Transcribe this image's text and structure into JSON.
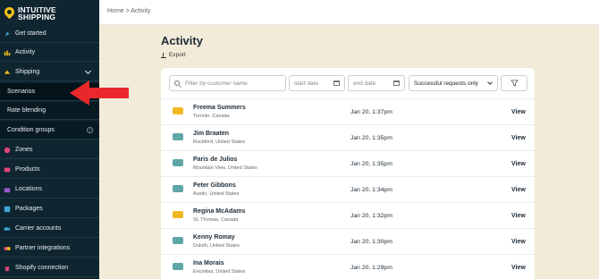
{
  "brand": {
    "line1": "INTUITIVE",
    "line2": "SHIPPING",
    "color": "#f4c21b"
  },
  "sidebar": {
    "items": [
      {
        "label": "Get started",
        "icon": "rocket-icon"
      },
      {
        "label": "Activity",
        "icon": "activity-icon"
      },
      {
        "label": "Shipping",
        "icon": "shipping-icon"
      },
      {
        "label": "Scenarios",
        "sub": true
      },
      {
        "label": "Rate blending",
        "sub": true
      },
      {
        "label": "Condition groups",
        "sub": true
      },
      {
        "label": "Zones",
        "icon": "zones-icon"
      },
      {
        "label": "Products",
        "icon": "products-icon"
      },
      {
        "label": "Locations",
        "icon": "locations-icon"
      },
      {
        "label": "Packages",
        "icon": "packages-icon"
      },
      {
        "label": "Carrier accounts",
        "icon": "truck-icon"
      },
      {
        "label": "Partner integrations",
        "icon": "partner-icon"
      },
      {
        "label": "Shopify connection",
        "icon": "shopify-icon"
      }
    ]
  },
  "breadcrumb": "Home > Activity",
  "page": {
    "title": "Activity",
    "export_label": "Export"
  },
  "filters": {
    "search_placeholder": "Filter by customer name",
    "start_date_placeholder": "start date",
    "end_date_placeholder": "end date",
    "status_selected": "Successful requests only"
  },
  "rows": [
    {
      "name": "Freema Summers",
      "location": "Toronto, Canada",
      "date": "Jan 20, 1:37pm",
      "action": "View",
      "flag": "canada"
    },
    {
      "name": "Jim Braaten",
      "location": "Rockford, United States",
      "date": "Jan 20, 1:35pm",
      "action": "View",
      "flag": "usa"
    },
    {
      "name": "Paris de Julios",
      "location": "Mountain View, United States",
      "date": "Jan 20, 1:35pm",
      "action": "View",
      "flag": "usa"
    },
    {
      "name": "Peter Gibbons",
      "location": "Austin, United States",
      "date": "Jan 20, 1:34pm",
      "action": "View",
      "flag": "usa"
    },
    {
      "name": "Regina McAdams",
      "location": "St. Thomas, Canada",
      "date": "Jan 20, 1:32pm",
      "action": "View",
      "flag": "canada"
    },
    {
      "name": "Kenny Romay",
      "location": "Duluth, United States",
      "date": "Jan 20, 1:30pm",
      "action": "View",
      "flag": "usa"
    },
    {
      "name": "Ina Morais",
      "location": "Encinitas, United States",
      "date": "Jan 20, 1:29pm",
      "action": "View",
      "flag": "usa"
    }
  ],
  "colors": {
    "sidebar": "#0f2530",
    "accent_arrow": "#e8282b",
    "canada_flag": "#f2b824",
    "usa_flag": "#5fa7a6"
  }
}
